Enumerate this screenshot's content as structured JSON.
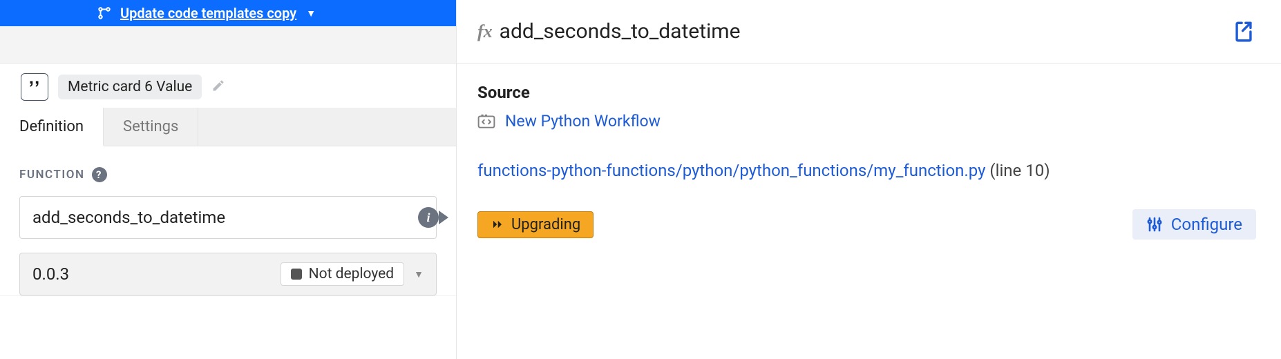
{
  "topbar": {
    "branch_label": "Update code templates copy"
  },
  "chip": {
    "label": "Metric card 6 Value"
  },
  "tabs": {
    "definition": "Definition",
    "settings": "Settings"
  },
  "function": {
    "section_label": "FUNCTION",
    "name": "add_seconds_to_datetime",
    "version": "0.0.3",
    "deploy_status": "Not deployed"
  },
  "detail": {
    "fx": "fx",
    "name": "add_seconds_to_datetime",
    "source_heading": "Source",
    "workflow_link": "New Python Workflow",
    "path_link": "functions-python-functions/python/python_functions/my_function.py",
    "line_suffix": " (line 10)",
    "upgrade_label": "Upgrading",
    "configure_label": "Configure"
  }
}
